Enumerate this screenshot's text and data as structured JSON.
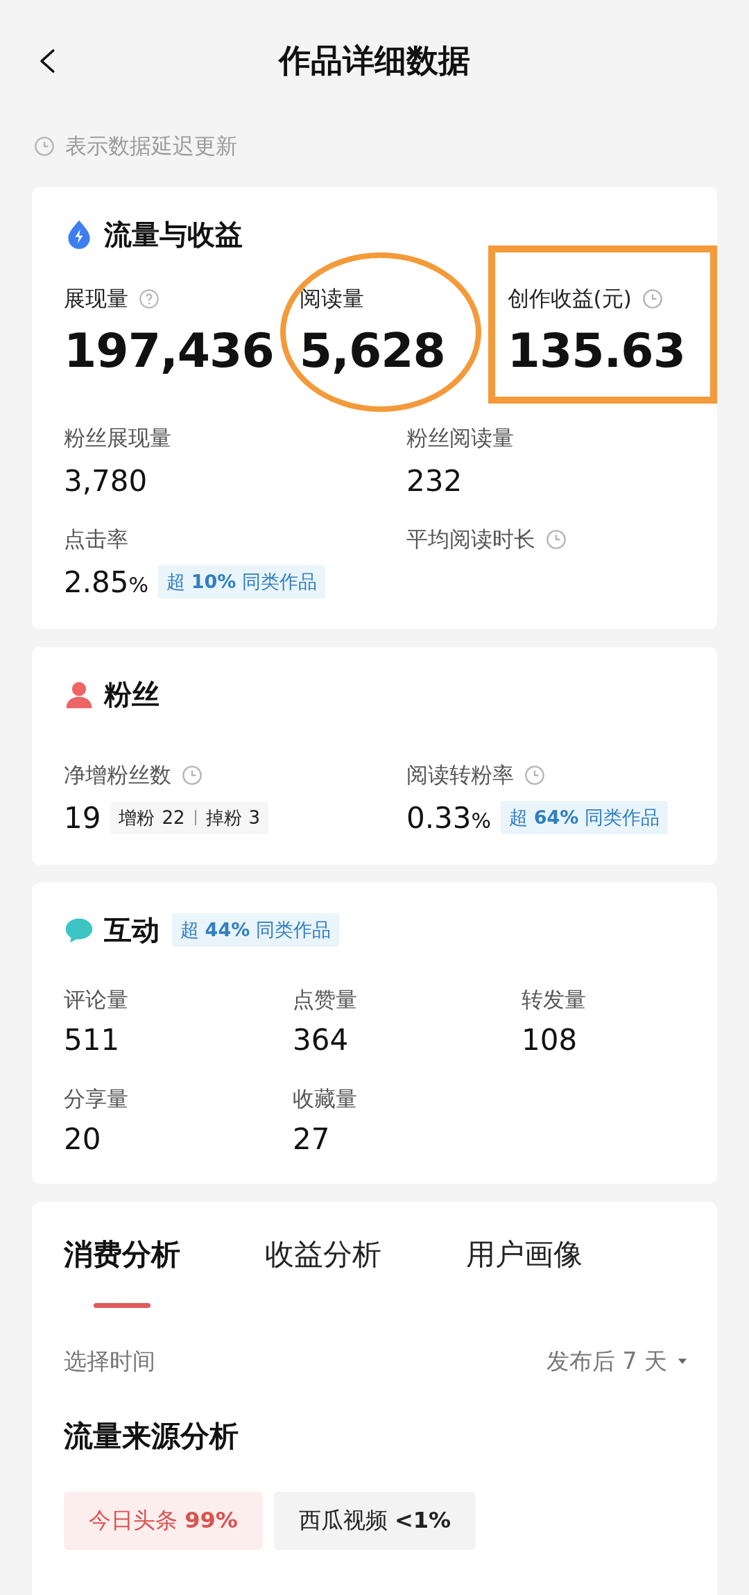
{
  "header": {
    "title": "作品详细数据"
  },
  "notice": "表示数据延迟更新",
  "traffic": {
    "title": "流量与收益",
    "main_metrics": [
      {
        "label": "展现量",
        "help": true,
        "delayed": false,
        "value": "197,436",
        "circled": false,
        "boxed": false
      },
      {
        "label": "阅读量",
        "help": false,
        "delayed": false,
        "value": "5,628",
        "circled": true,
        "boxed": false
      },
      {
        "label": "创作收益(元)",
        "help": false,
        "delayed": true,
        "value": "135.63",
        "circled": false,
        "boxed": true
      }
    ],
    "metrics": [
      {
        "label": "粉丝展现量",
        "delayed": false,
        "value": "3,780"
      },
      {
        "label": "粉丝阅读量",
        "delayed": false,
        "value": "232"
      },
      {
        "label": "点击率",
        "delayed": false,
        "value": "2.85",
        "unit": "%",
        "badge": "超 **10%** 同类作品"
      },
      {
        "label": "平均阅读时长",
        "delayed": true
      }
    ]
  },
  "fans": {
    "title": "粉丝",
    "metrics": [
      {
        "label": "净增粉丝数",
        "delayed": true,
        "value": "19",
        "gain_label": "增粉",
        "gain": "22",
        "loss_label": "掉粉",
        "loss": "3"
      },
      {
        "label": "阅读转粉率",
        "delayed": true,
        "value": "0.33",
        "unit": "%",
        "badge": "超 **64%** 同类作品"
      }
    ]
  },
  "interaction": {
    "title": "互动",
    "badge": "超 **44%** 同类作品",
    "metrics": [
      {
        "label": "评论量",
        "value": "511"
      },
      {
        "label": "点赞量",
        "value": "364"
      },
      {
        "label": "转发量",
        "value": "108"
      },
      {
        "label": "分享量",
        "value": "20"
      },
      {
        "label": "收藏量",
        "value": "27"
      }
    ]
  },
  "analysis": {
    "tabs": [
      {
        "label": "消费分析",
        "selected": true
      },
      {
        "label": "收益分析",
        "selected": false
      },
      {
        "label": "用户画像",
        "selected": false
      }
    ],
    "time_label": "选择时间",
    "time_value": "发布后 7 天",
    "section_title": "流量来源分析",
    "sources": [
      {
        "label": "今日头条 **99%**",
        "selected": true
      },
      {
        "label": "西瓜视频 **<1%**",
        "selected": false
      }
    ]
  }
}
